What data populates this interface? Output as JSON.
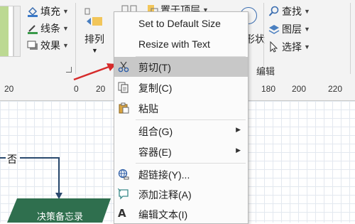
{
  "ribbon": {
    "fill_label": "填充",
    "line_label": "线条",
    "effect_label": "效果",
    "arrange_label": "排列",
    "bring_to_front_label": "置于顶层",
    "shape_style_fragment": "形状",
    "find_label": "查找",
    "layers_label": "图层",
    "select_label": "选择",
    "editing_group_label": "编辑"
  },
  "ruler": {
    "ticks": [
      "20",
      "0",
      "20",
      "180",
      "200",
      "220"
    ]
  },
  "canvas": {
    "no_label": "否",
    "decision_shape_label": "决策备忘录",
    "accent_colors": {
      "shape_fill": "#2f6f4e",
      "connector": "#2b4a6e",
      "annotation_arrow": "#d62b2b"
    }
  },
  "context_menu": {
    "set_default_size": "Set to Default Size",
    "resize_with_text": "Resize with Text",
    "cut": "剪切(T)",
    "copy": "复制(C)",
    "paste": "粘贴",
    "group": "组合(G)",
    "container": "容器(E)",
    "hyperlink": "超链接(Y)...",
    "add_comment": "添加注释(A)",
    "edit_text": "编辑文本(I)"
  }
}
